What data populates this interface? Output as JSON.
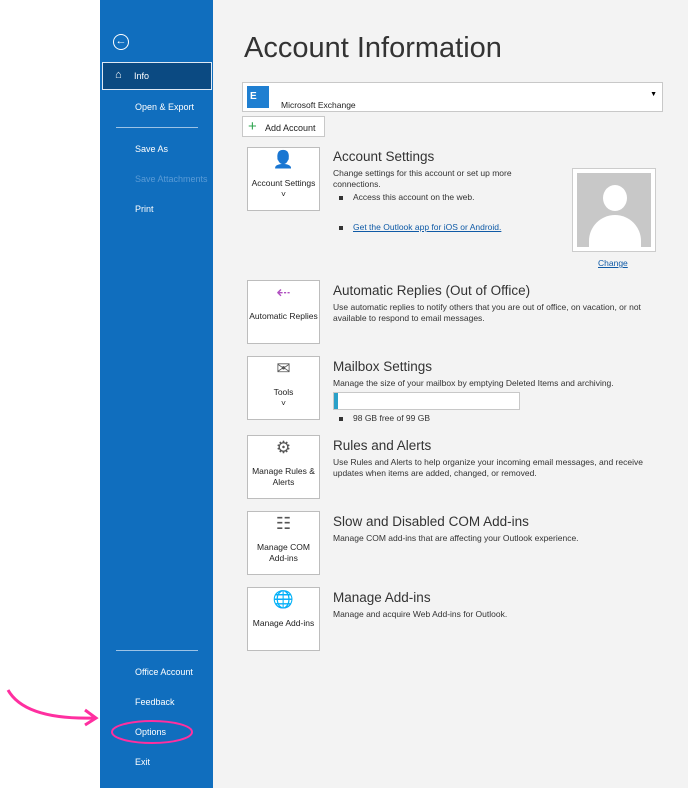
{
  "sidebar": {
    "items": [
      {
        "label": "Info"
      },
      {
        "label": "Open & Export"
      },
      {
        "label": "Save As"
      },
      {
        "label": "Save Attachments"
      },
      {
        "label": "Print"
      },
      {
        "label": "Office Account"
      },
      {
        "label": "Feedback"
      },
      {
        "label": "Options"
      },
      {
        "label": "Exit"
      }
    ]
  },
  "main": {
    "title": "Account Information",
    "account": "Microsoft Exchange",
    "add_account": "Add Account",
    "account_settings": {
      "tile": "Account Settings",
      "title": "Account Settings",
      "desc": "Change settings for this account or set up more connections.",
      "bullet1": "Access this account on the web.",
      "link": "Get the Outlook app for iOS or Android.",
      "change": "Change"
    },
    "auto_replies": {
      "tile": "Automatic Replies",
      "title": "Automatic Replies (Out of Office)",
      "desc": "Use automatic replies to notify others that you are out of office, on vacation, or not available to respond to email messages."
    },
    "mailbox": {
      "tile": "Tools",
      "title": "Mailbox Settings",
      "desc": "Manage the size of your mailbox by emptying Deleted Items and archiving.",
      "usage_percent": 1,
      "free": "98 GB free of 99 GB"
    },
    "rules": {
      "tile": "Manage Rules & Alerts",
      "title": "Rules and Alerts",
      "desc": "Use Rules and Alerts to help organize your incoming email messages, and receive updates when items are added, changed, or removed."
    },
    "com": {
      "tile": "Manage COM Add-ins",
      "title": "Slow and Disabled COM Add-ins",
      "desc": "Manage COM add-ins that are affecting your Outlook experience."
    },
    "addins": {
      "tile": "Manage Add-ins",
      "title": "Manage Add-ins",
      "desc": "Manage and acquire Web Add-ins for Outlook."
    }
  },
  "colors": {
    "sidebar": "#106ebe",
    "annotation": "#ff2fa0"
  }
}
